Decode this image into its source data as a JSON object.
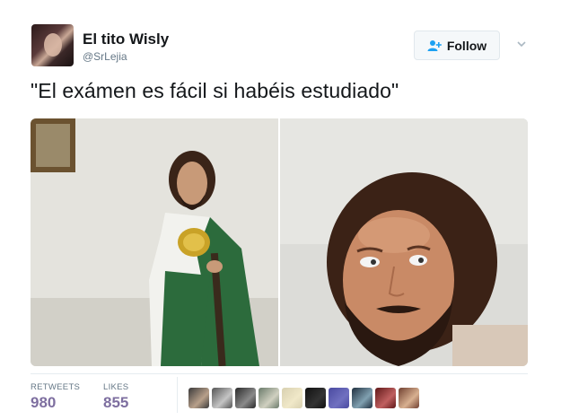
{
  "author": {
    "name": "El tito Wisly",
    "handle": "@SrLejia"
  },
  "follow_button": {
    "label": "Follow",
    "icon": "add-user-icon"
  },
  "menu": {
    "icon": "chevron-down-icon"
  },
  "tweet": {
    "text": "\"El exámen es fácil si habéis estudiado\""
  },
  "stats": {
    "retweets_label": "RETWEETS",
    "retweets_value": "980",
    "likes_label": "LIKES",
    "likes_value": "855"
  },
  "likers": [
    {
      "color_a": "#3a3a3a",
      "color_b": "#b8a08a"
    },
    {
      "color_a": "#555555",
      "color_b": "#c4c4c4"
    },
    {
      "color_a": "#2a2a2a",
      "color_b": "#8a8a8a"
    },
    {
      "color_a": "#6a7a6a",
      "color_b": "#d0d0c0"
    },
    {
      "color_a": "#d8d0b0",
      "color_b": "#f0e8c8"
    },
    {
      "color_a": "#111111",
      "color_b": "#333333"
    },
    {
      "color_a": "#4a4aa0",
      "color_b": "#7070c0"
    },
    {
      "color_a": "#203040",
      "color_b": "#80a0b0"
    },
    {
      "color_a": "#601818",
      "color_b": "#c06060"
    },
    {
      "color_a": "#704030",
      "color_b": "#d8b090"
    }
  ],
  "colors": {
    "accent": "#1da1f2",
    "stat_value": "#7e6fa0",
    "secondary_text": "#657786"
  }
}
